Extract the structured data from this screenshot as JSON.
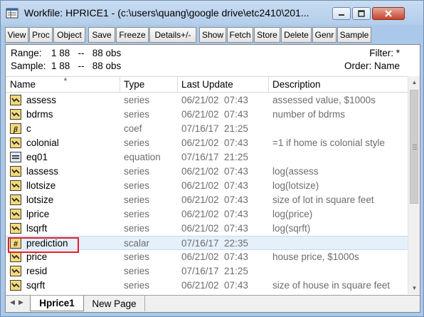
{
  "window": {
    "title": "Workfile: HPRICE1 - (c:\\users\\quang\\google drive\\etc2410\\201..."
  },
  "toolbar": {
    "buttons": [
      "View",
      "Proc",
      "Object",
      "Save",
      "Freeze",
      "Details+/-",
      "Show",
      "Fetch",
      "Store",
      "Delete",
      "Genr",
      "Sample"
    ]
  },
  "info": {
    "range_label": "Range:",
    "range_value": "1 88   --   88 obs",
    "sample_label": "Sample:",
    "sample_value": "1 88   --   88 obs",
    "filter": "Filter: *",
    "order": "Order: Name"
  },
  "columns": {
    "name": "Name",
    "type": "Type",
    "last_update": "Last Update",
    "description": "Description"
  },
  "rows": [
    {
      "icon": "series-icon",
      "name": "assess",
      "type": "series",
      "date": "06/21/02",
      "time": "07:43",
      "description": "assessed value, $1000s"
    },
    {
      "icon": "series-icon",
      "name": "bdrms",
      "type": "series",
      "date": "06/21/02",
      "time": "07:43",
      "description": "number of bdrms"
    },
    {
      "icon": "coef-icon",
      "name": "c",
      "type": "coef",
      "date": "07/16/17",
      "time": "21:25",
      "description": ""
    },
    {
      "icon": "series-icon",
      "name": "colonial",
      "type": "series",
      "date": "06/21/02",
      "time": "07:43",
      "description": "=1 if home is colonial style"
    },
    {
      "icon": "equation-icon",
      "name": "eq01",
      "type": "equation",
      "date": "07/16/17",
      "time": "21:25",
      "description": ""
    },
    {
      "icon": "series-icon",
      "name": "lassess",
      "type": "series",
      "date": "06/21/02",
      "time": "07:43",
      "description": "log(assess"
    },
    {
      "icon": "series-icon",
      "name": "llotsize",
      "type": "series",
      "date": "06/21/02",
      "time": "07:43",
      "description": "log(lotsize)"
    },
    {
      "icon": "series-icon",
      "name": "lotsize",
      "type": "series",
      "date": "06/21/02",
      "time": "07:43",
      "description": "size of lot in square feet"
    },
    {
      "icon": "series-icon",
      "name": "lprice",
      "type": "series",
      "date": "06/21/02",
      "time": "07:43",
      "description": "log(price)"
    },
    {
      "icon": "series-icon",
      "name": "lsqrft",
      "type": "series",
      "date": "06/21/02",
      "time": "07:43",
      "description": "log(sqrft)"
    },
    {
      "icon": "scalar-icon",
      "name": "prediction",
      "type": "scalar",
      "date": "07/16/17",
      "time": "22:35",
      "description": "",
      "selected": true
    },
    {
      "icon": "series-icon",
      "name": "price",
      "type": "series",
      "date": "06/21/02",
      "time": "07:43",
      "description": "house price, $1000s"
    },
    {
      "icon": "series-icon",
      "name": "resid",
      "type": "series",
      "date": "07/16/17",
      "time": "21:25",
      "description": ""
    },
    {
      "icon": "series-icon",
      "name": "sqrft",
      "type": "series",
      "date": "06/21/02",
      "time": "07:43",
      "description": "size of house in square feet"
    }
  ],
  "tabs": {
    "active": "Hprice1",
    "new_page": "New Page"
  },
  "colors": {
    "frame": "#aac8e9",
    "selected_row": "#e5f0fb",
    "highlight": "#e0202a",
    "icon_yellow": "#f5d97a"
  }
}
